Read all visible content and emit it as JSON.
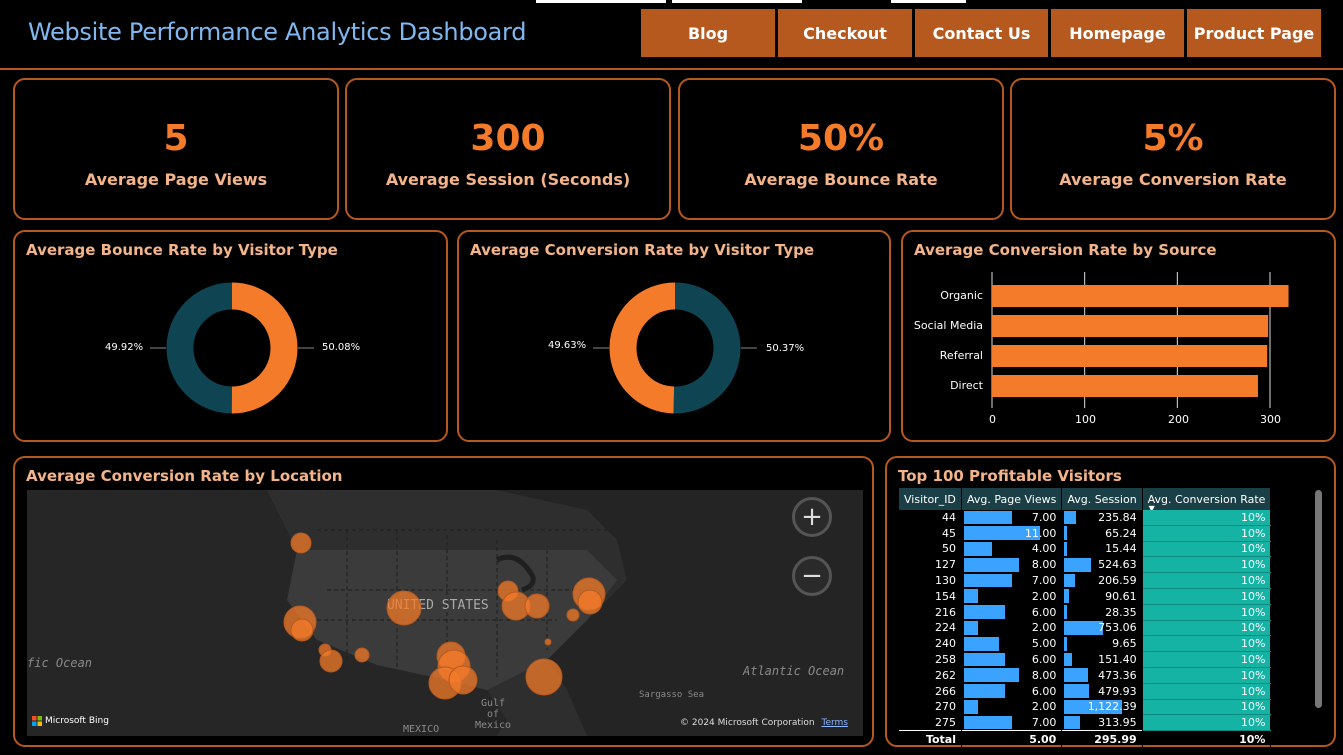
{
  "header": {
    "title": "Website Performance Analytics Dashboard",
    "nav": [
      "Blog",
      "Checkout",
      "Contact Us",
      "Homepage",
      "Product Page"
    ]
  },
  "kpis": [
    {
      "value": "5",
      "label": "Average Page Views"
    },
    {
      "value": "300",
      "label": "Average Session (Seconds)"
    },
    {
      "value": "50%",
      "label": "Average Bounce Rate"
    },
    {
      "value": "5%",
      "label": "Average Conversion Rate"
    }
  ],
  "chart_data": [
    {
      "type": "pie",
      "title": "Average Bounce Rate by Visitor Type",
      "slices": [
        {
          "value": 50.08,
          "label": "50.08%",
          "color": "#f47b2a"
        },
        {
          "value": 49.92,
          "label": "49.92%",
          "color": "#0f4553"
        }
      ]
    },
    {
      "type": "pie",
      "title": "Average Conversion Rate by Visitor Type",
      "slices": [
        {
          "value": 50.37,
          "label": "50.37%",
          "color": "#0f4553"
        },
        {
          "value": 49.63,
          "label": "49.63%",
          "color": "#f47b2a"
        }
      ]
    },
    {
      "type": "bar",
      "title": "Average Conversion Rate by Source",
      "categories": [
        "Organic",
        "Social Media",
        "Referral",
        "Direct"
      ],
      "values": [
        320,
        298,
        297,
        287
      ],
      "xlim": [
        0,
        300
      ],
      "ticks": [
        "0",
        "100",
        "200",
        "300"
      ],
      "color": "#f47b2a"
    }
  ],
  "map": {
    "title": "Average Conversion Rate by Location",
    "labels": {
      "country": "UNITED STATES",
      "ocean_w": "fic Ocean",
      "ocean_e": "Atlantic Ocean",
      "gulf": "Gulf of Mexico",
      "sargasso": "Sargasso Sea",
      "mexico": "MEXICO"
    },
    "attribution": "© 2024 Microsoft Corporation",
    "terms": "Terms",
    "brand": "Microsoft Bing",
    "zoom_in": "+",
    "zoom_out": "−"
  },
  "table": {
    "title": "Top 100 Profitable Visitors",
    "columns": [
      "Visitor_ID",
      "Avg. Page Views",
      "Avg. Session",
      "Avg. Conversion Rate"
    ],
    "rows": [
      [
        "44",
        7.0,
        "235.84",
        "10%"
      ],
      [
        "45",
        11.0,
        "65.24",
        "10%"
      ],
      [
        "50",
        4.0,
        "15.44",
        "10%"
      ],
      [
        "127",
        8.0,
        "524.63",
        "10%"
      ],
      [
        "130",
        7.0,
        "206.59",
        "10%"
      ],
      [
        "154",
        2.0,
        "90.61",
        "10%"
      ],
      [
        "216",
        6.0,
        "28.35",
        "10%"
      ],
      [
        "224",
        2.0,
        "753.06",
        "10%"
      ],
      [
        "240",
        5.0,
        "9.65",
        "10%"
      ],
      [
        "258",
        6.0,
        "151.40",
        "10%"
      ],
      [
        "262",
        8.0,
        "473.36",
        "10%"
      ],
      [
        "266",
        6.0,
        "479.93",
        "10%"
      ],
      [
        "270",
        2.0,
        "1,122.39",
        "10%"
      ],
      [
        "275",
        7.0,
        "313.95",
        "10%"
      ]
    ],
    "total": [
      "Total",
      "5.00",
      "295.99",
      "10%"
    ]
  }
}
